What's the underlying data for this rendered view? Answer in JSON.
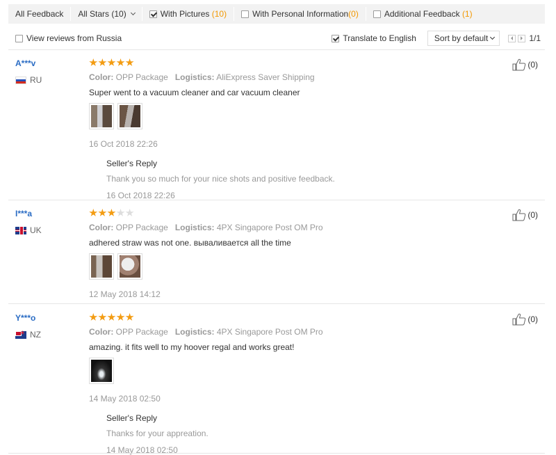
{
  "filters": {
    "all_feedback": "All Feedback",
    "all_stars": "All Stars (10)",
    "with_pictures": "With Pictures",
    "with_pictures_count": "(10)",
    "personal_info": "With Personal Information",
    "personal_info_count": "(0)",
    "additional": "Additional Feedback",
    "additional_count": "(1)"
  },
  "options": {
    "russia": "View reviews from Russia",
    "translate": "Translate to English",
    "sort": "Sort by default",
    "page": "1/1"
  },
  "reviews": [
    {
      "user": "A***v",
      "country": "RU",
      "rating": 5,
      "color_label": "Color:",
      "color": "OPP Package",
      "logistics_label": "Logistics:",
      "logistics": "AliExpress Saver Shipping",
      "text": "Super went to a vacuum cleaner and car vacuum cleaner",
      "date": "16 Oct 2018 22:26",
      "helpful": "(0)",
      "reply": {
        "title": "Seller's Reply",
        "text": "Thank you so much for your nice shots and positive feedback.",
        "date": "16 Oct 2018 22:26"
      }
    },
    {
      "user": "I***a",
      "country": "UK",
      "rating": 3,
      "color_label": "Color:",
      "color": "OPP Package",
      "logistics_label": "Logistics:",
      "logistics": "4PX Singapore Post OM Pro",
      "text": "adhered straw was not one. вываливается all the time",
      "date": "12 May 2018 14:12",
      "helpful": "(0)"
    },
    {
      "user": "Y***o",
      "country": "NZ",
      "rating": 5,
      "color_label": "Color:",
      "color": "OPP Package",
      "logistics_label": "Logistics:",
      "logistics": "4PX Singapore Post OM Pro",
      "text": "amazing. it fits well to my hoover regal and works great!",
      "date": "14 May 2018 02:50",
      "helpful": "(0)",
      "reply": {
        "title": "Seller's Reply",
        "text": "Thanks for your appreation.",
        "date": "14 May 2018 02:50"
      }
    }
  ],
  "colors": {
    "accent": "#f39800",
    "link": "#2a6cc4",
    "star": "#f39c12"
  }
}
